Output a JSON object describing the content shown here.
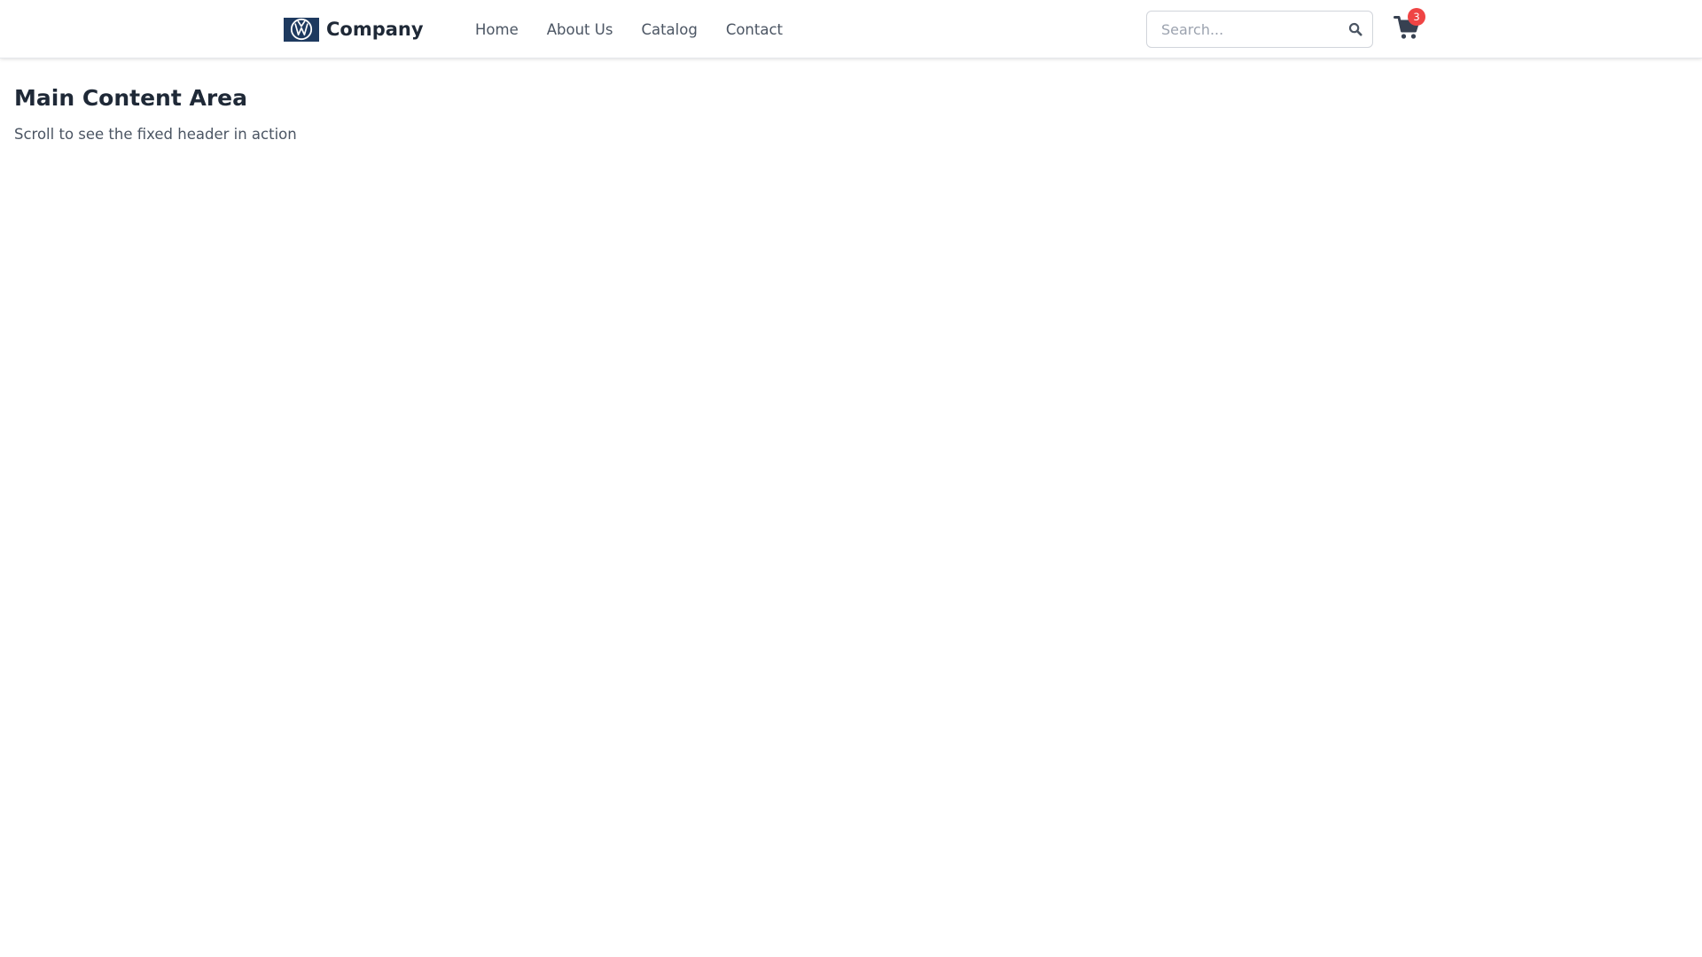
{
  "header": {
    "brand": {
      "name": "Company",
      "logo_icon": "vw-logo-icon",
      "logo_color": "#1e3a5f"
    },
    "nav": [
      {
        "label": "Home"
      },
      {
        "label": "About Us"
      },
      {
        "label": "Catalog"
      },
      {
        "label": "Contact"
      }
    ],
    "search": {
      "placeholder": "Search...",
      "value": "",
      "icon": "search-icon"
    },
    "cart": {
      "icon": "shopping-cart-icon",
      "count": "3",
      "badge_color": "#ef4444"
    }
  },
  "main": {
    "title": "Main Content Area",
    "subtitle": "Scroll to see the fixed header in action"
  }
}
